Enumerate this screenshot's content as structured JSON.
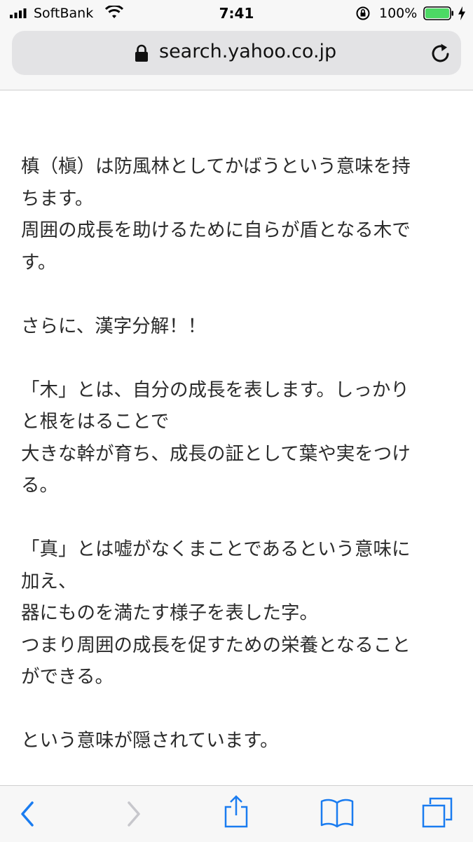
{
  "status_bar": {
    "carrier": "SoftBank",
    "time": "7:41",
    "battery_percent": "100%",
    "battery_level": 1.0,
    "battery_color": "#4cd964"
  },
  "address_bar": {
    "url": "search.yahoo.co.jp"
  },
  "article": {
    "paragraphs": [
      [
        "槙（槇）は防風林としてかばうという意味を持",
        "ちます。",
        "周囲の成長を助けるために自らが盾となる木で",
        "す。"
      ],
      [
        "さらに、漢字分解！！"
      ],
      [
        "「木」とは、自分の成長を表します。しっかり",
        "と根をはることで",
        "大きな幹が育ち、成長の証として葉や実をつけ",
        "る。"
      ],
      [
        "「真」とは嘘がなくまことであるという意味に",
        "加え、",
        "器にものを満たす様子を表した字。",
        "つまり周囲の成長を促すための栄養となること",
        "ができる。"
      ],
      [
        "という意味が隠されています。"
      ]
    ]
  },
  "toolbar": {
    "accent": "#1a7cf0",
    "disabled": "#c7c7cc",
    "icons": [
      "back-icon",
      "forward-icon",
      "share-icon",
      "bookmarks-icon",
      "tabs-icon"
    ]
  }
}
